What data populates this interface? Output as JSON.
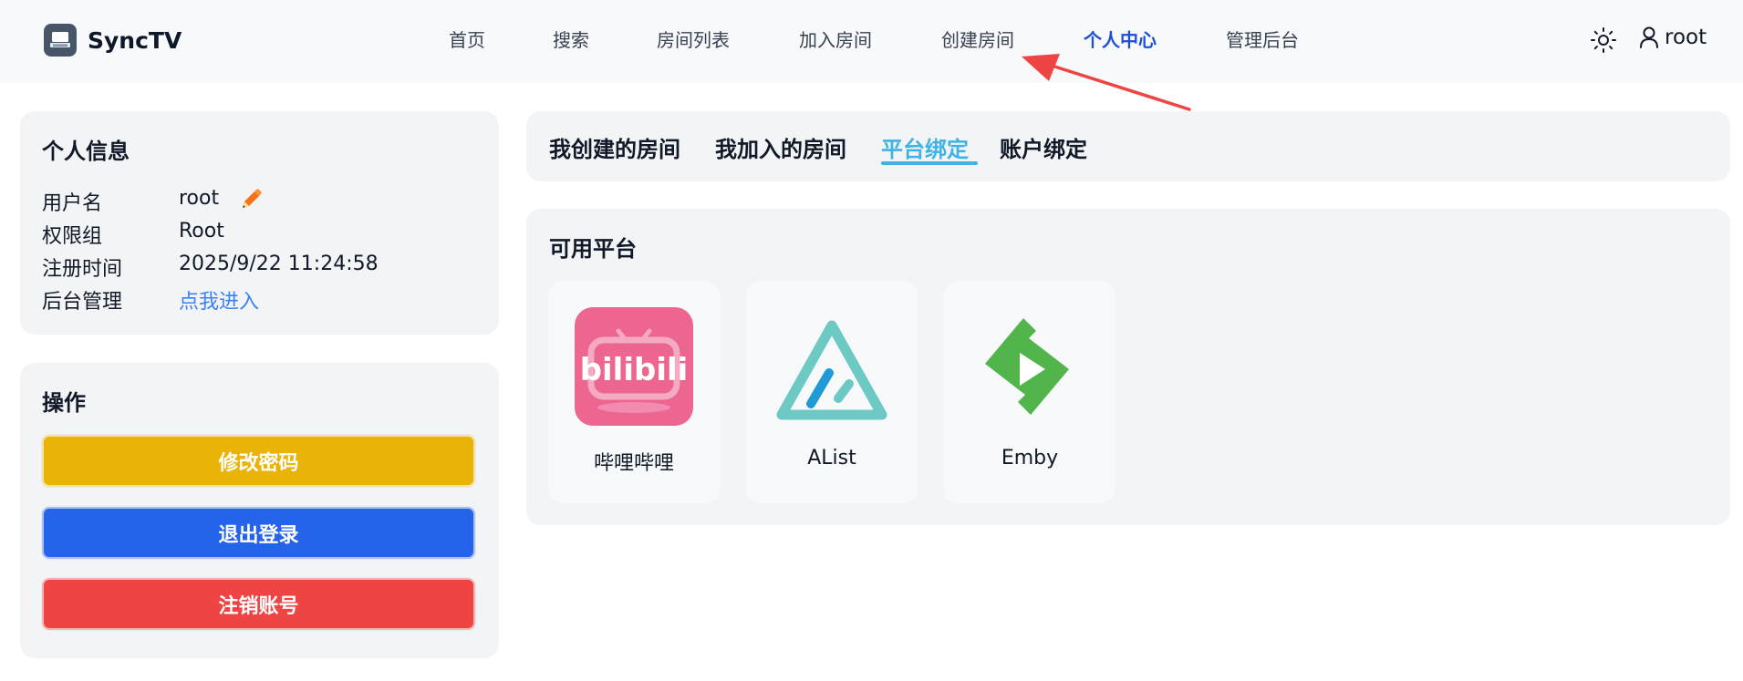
{
  "app": {
    "name": "SyncTV"
  },
  "nav": {
    "items": [
      "首页",
      "搜索",
      "房间列表",
      "加入房间",
      "创建房间",
      "个人中心",
      "管理后台"
    ],
    "active": "个人中心"
  },
  "user": {
    "name": "root"
  },
  "profile": {
    "title": "个人信息",
    "rows": [
      {
        "label": "用户名",
        "value": "root"
      },
      {
        "label": "权限组",
        "value": "Root"
      },
      {
        "label": "注册时间",
        "value": "2025/9/22 11:24:58"
      },
      {
        "label": "后台管理",
        "value": "点我进入"
      }
    ]
  },
  "actions": {
    "title": "操作",
    "buttons": [
      {
        "label": "修改密码",
        "color": "#eab308"
      },
      {
        "label": "退出登录",
        "color": "#2563eb"
      },
      {
        "label": "注销账号",
        "color": "#ef4444"
      }
    ]
  },
  "tabs": {
    "items": [
      "我创建的房间",
      "我加入的房间",
      "平台绑定",
      "账户绑定"
    ],
    "active": "平台绑定"
  },
  "platforms": {
    "title": "可用平台",
    "items": [
      {
        "name": "哔哩哔哩",
        "icon": "bilibili-icon",
        "color": "#ec6690"
      },
      {
        "name": "AList",
        "icon": "alist-icon",
        "color": "#6cc9c3"
      },
      {
        "name": "Emby",
        "icon": "emby-icon",
        "color": "#52b54b"
      }
    ]
  },
  "colors": {
    "accent": "#1d4ed8",
    "tab_accent": "#3fb3e6",
    "annotation_arrow": "#ef4444"
  }
}
